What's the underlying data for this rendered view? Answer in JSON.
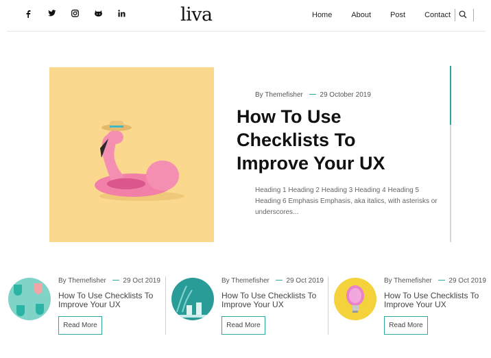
{
  "header": {
    "logo": "liva",
    "social": [
      "facebook-icon",
      "twitter-icon",
      "instagram-icon",
      "github-icon",
      "linkedin-icon"
    ],
    "nav": [
      "Home",
      "About",
      "Post",
      "Contact"
    ],
    "search_icon": "search-icon"
  },
  "feature": {
    "author": "By Themefisher",
    "date": "29 October 2019",
    "title": "How To Use Checklists To Improve Your UX",
    "excerpt": "Heading 1 Heading 2 Heading 3 Heading 4 Heading 5 Heading 6 Emphasis Emphasis, aka italics, with asterisks or underscores...",
    "image": "pink-flamingo-float-image"
  },
  "cards": [
    {
      "author": "By Themefisher",
      "date": "29 Oct 2019",
      "title": "How To Use Checklists To Improve Your UX",
      "button": "Read More",
      "image": "teal-cups-image"
    },
    {
      "author": "By Themefisher",
      "date": "29 Oct 2019",
      "title": "How To Use Checklists To Improve Your UX",
      "button": "Read More",
      "image": "teal-plants-image"
    },
    {
      "author": "By Themefisher",
      "date": "29 Oct 2019",
      "title": "How To Use Checklists To Improve Your UX",
      "button": "Read More",
      "image": "pink-bulb-image"
    }
  ],
  "colors": {
    "accent": "#2aa89a",
    "feature_bg": "#fad98e"
  }
}
